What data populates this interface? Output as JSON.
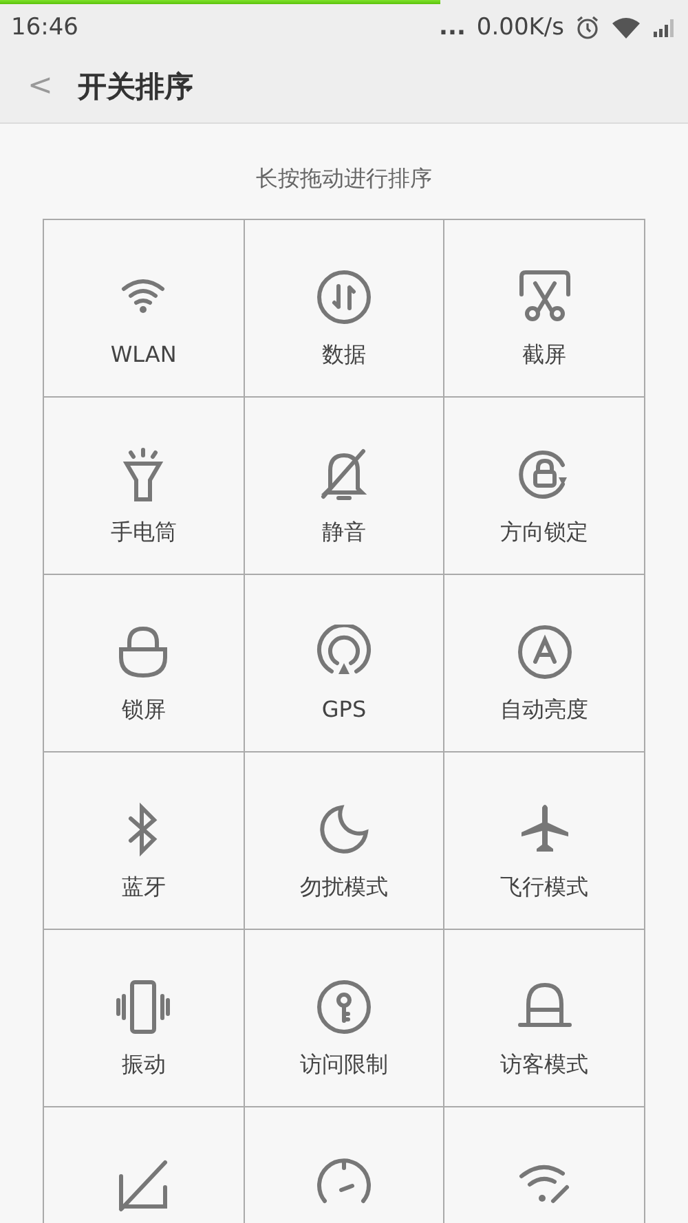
{
  "status_bar": {
    "load_bar": {
      "level": 0.64
    },
    "time": "16:46",
    "dots": "...",
    "speed": "0.00K/s"
  },
  "header": {
    "back": "<",
    "title": "开关排序"
  },
  "hint": "长按拖动进行排序",
  "tiles": [
    {
      "kind": "wifi",
      "label": "WLAN"
    },
    {
      "kind": "data",
      "label": "数据"
    },
    {
      "kind": "screenshot",
      "label": "截屏"
    },
    {
      "kind": "flashlight",
      "label": "手电筒"
    },
    {
      "kind": "mute",
      "label": "静音"
    },
    {
      "kind": "rotation-lock",
      "label": "方向锁定"
    },
    {
      "kind": "lock",
      "label": "锁屏"
    },
    {
      "kind": "gps",
      "label": "GPS"
    },
    {
      "kind": "auto-brightness",
      "label": "自动亮度"
    },
    {
      "kind": "bluetooth",
      "label": "蓝牙"
    },
    {
      "kind": "moon",
      "label": "勿扰模式"
    },
    {
      "kind": "airplane",
      "label": "飞行模式"
    },
    {
      "kind": "vibrate",
      "label": "振动"
    },
    {
      "kind": "key",
      "label": "访问限制"
    },
    {
      "kind": "guest",
      "label": "访客模式"
    },
    {
      "kind": "signal-off"
    },
    {
      "kind": "gauge"
    },
    {
      "kind": "wifi-link"
    }
  ]
}
